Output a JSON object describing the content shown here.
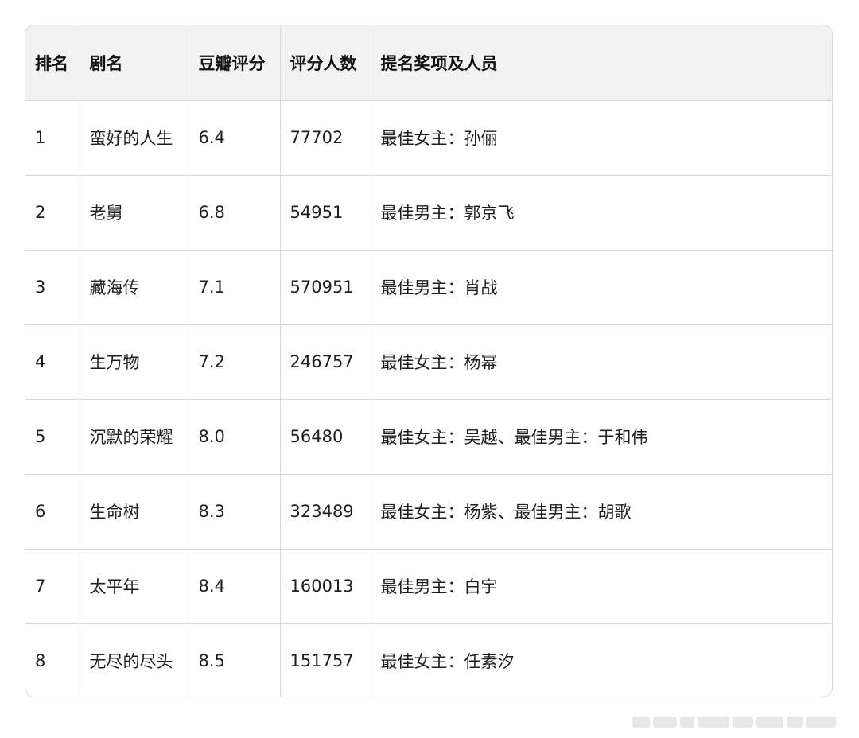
{
  "table": {
    "headers": [
      "排名",
      "剧名",
      "豆瓣评分",
      "评分人数",
      "提名奖项及人员"
    ],
    "rows": [
      [
        "1",
        "蛮好的人生",
        "6.4",
        "77702",
        "最佳女主：孙俪"
      ],
      [
        "2",
        "老舅",
        "6.8",
        "54951",
        "最佳男主：郭京飞"
      ],
      [
        "3",
        "藏海传",
        "7.1",
        "570951",
        "最佳男主：肖战"
      ],
      [
        "4",
        "生万物",
        "7.2",
        "246757",
        "最佳女主：杨幂"
      ],
      [
        "5",
        "沉默的荣耀",
        "8.0",
        "56480",
        "最佳女主：吴越、最佳男主：于和伟"
      ],
      [
        "6",
        "生命树",
        "8.3",
        "323489",
        "最佳女主：杨紫、最佳男主：胡歌"
      ],
      [
        "7",
        "太平年",
        "8.4",
        "160013",
        "最佳男主：白宇"
      ],
      [
        "8",
        "无尽的尽头",
        "8.5",
        "151757",
        "最佳女主：任素汐"
      ]
    ]
  },
  "colors": {
    "header_bg": "#f2f2f2",
    "border": "#d9d9d9"
  }
}
